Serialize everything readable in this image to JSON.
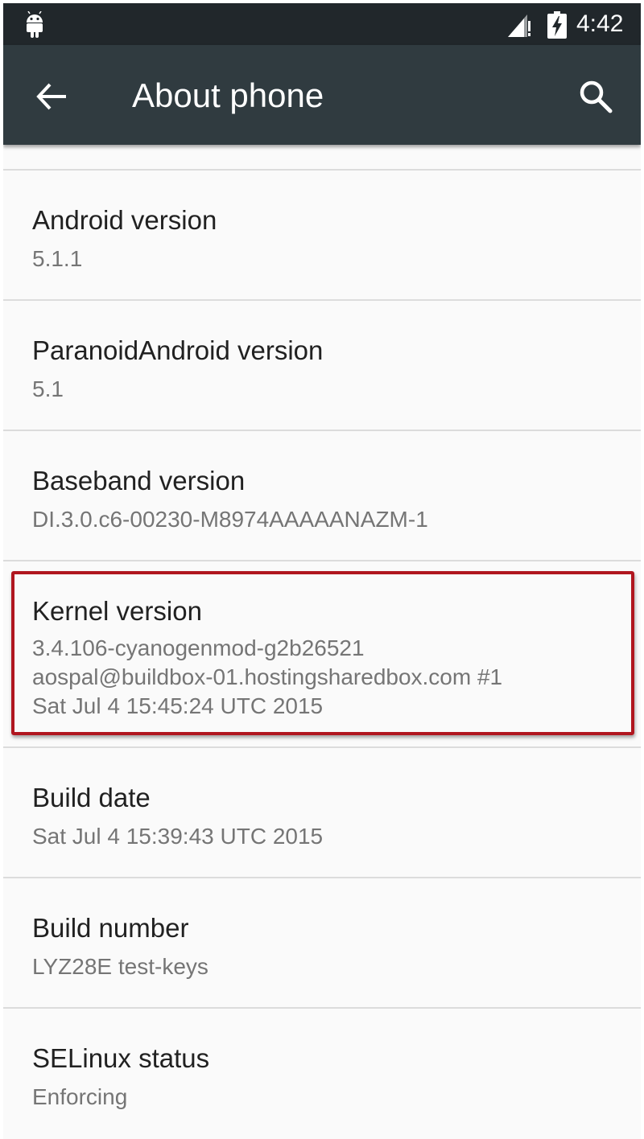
{
  "status_bar": {
    "time": "4:42",
    "icons": [
      "android-debug-icon",
      "signal-icon",
      "battery-charging-icon"
    ]
  },
  "toolbar": {
    "back_icon": "arrow-left-icon",
    "title": "About phone",
    "search_icon": "search-icon"
  },
  "preferences": [
    {
      "title": "Android version",
      "summary": "5.1.1"
    },
    {
      "title": "ParanoidAndroid version",
      "summary": "5.1"
    },
    {
      "title": "Baseband version",
      "summary": "DI.3.0.c6-00230-M8974AAAAANAZM-1"
    },
    {
      "title": "Kernel version",
      "summary": "3.4.106-cyanogenmod-g2b26521\naospal@buildbox-01.hostingsharedbox.com #1\nSat Jul 4 15:45:24 UTC 2015"
    },
    {
      "title": "Build date",
      "summary": "Sat Jul  4 15:39:43 UTC 2015"
    },
    {
      "title": "Build number",
      "summary": "LYZ28E test-keys"
    },
    {
      "title": "SELinux status",
      "summary": "Enforcing"
    }
  ],
  "colors": {
    "status_bar": "#21272b",
    "toolbar": "#303b40",
    "highlight": "#b0161f",
    "title_text": "#212121",
    "summary_text": "#757575"
  }
}
